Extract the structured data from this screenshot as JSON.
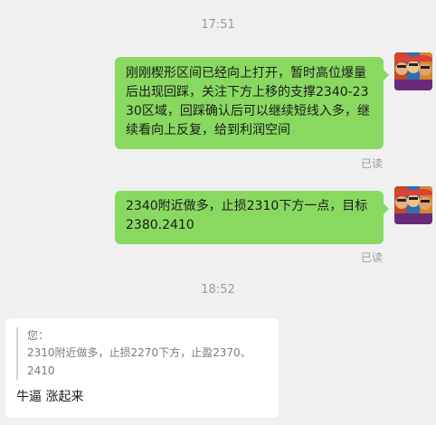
{
  "chat": {
    "timestamp_1": "17:51",
    "message_1": "刚刚楔形区间已经向上打开，暂时高位爆量后出现回踩，关注下方上移的支撑2340-2330区域，回踩确认后可以继续短线入多，继续看向上反复，给到利润空间",
    "read_1": "已读",
    "message_2": "2340附近做多，止损2310下方一点，目标2380.2410",
    "read_2": "已读",
    "timestamp_2": "18:52",
    "reply": {
      "quote_name": "您：",
      "quote_text": "2310附近做多，止损2270下方，止盈2370、2410",
      "text": "牛逼 涨起来"
    }
  },
  "colors": {
    "outgoing_bubble": "#89d961",
    "incoming_bubble": "#ffffff",
    "background": "#f0f0f0"
  },
  "icons": {
    "sender_avatar": "colorful-faces-avatar-icon"
  }
}
